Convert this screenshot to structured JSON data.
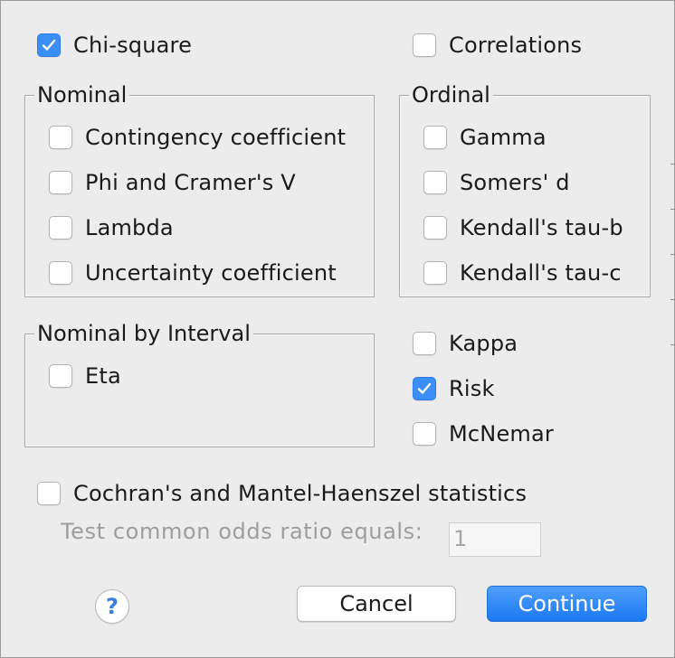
{
  "top": {
    "chi_square": {
      "label": "Chi-square",
      "checked": true
    },
    "correlations": {
      "label": "Correlations",
      "checked": false
    }
  },
  "nominal": {
    "title": "Nominal",
    "items": [
      {
        "label": "Contingency coefficient",
        "checked": false
      },
      {
        "label": "Phi and Cramer's V",
        "checked": false
      },
      {
        "label": "Lambda",
        "checked": false
      },
      {
        "label": "Uncertainty coefficient",
        "checked": false
      }
    ]
  },
  "ordinal": {
    "title": "Ordinal",
    "items": [
      {
        "label": "Gamma",
        "checked": false
      },
      {
        "label": "Somers' d",
        "checked": false
      },
      {
        "label": "Kendall's tau-b",
        "checked": false
      },
      {
        "label": "Kendall's tau-c",
        "checked": false
      }
    ]
  },
  "nominal_by_interval": {
    "title": "Nominal by Interval",
    "eta": {
      "label": "Eta",
      "checked": false
    }
  },
  "other": {
    "kappa": {
      "label": "Kappa",
      "checked": false
    },
    "risk": {
      "label": "Risk",
      "checked": true
    },
    "mcnemar": {
      "label": "McNemar",
      "checked": false
    }
  },
  "cochran": {
    "label": "Cochran's and Mantel-Haenszel statistics",
    "checked": false,
    "odds_label": "Test common odds ratio equals:",
    "odds_value": "1"
  },
  "buttons": {
    "help": "?",
    "cancel": "Cancel",
    "continue": "Continue"
  },
  "colors": {
    "accent": "#3b8ef5",
    "background": "#ececec"
  }
}
